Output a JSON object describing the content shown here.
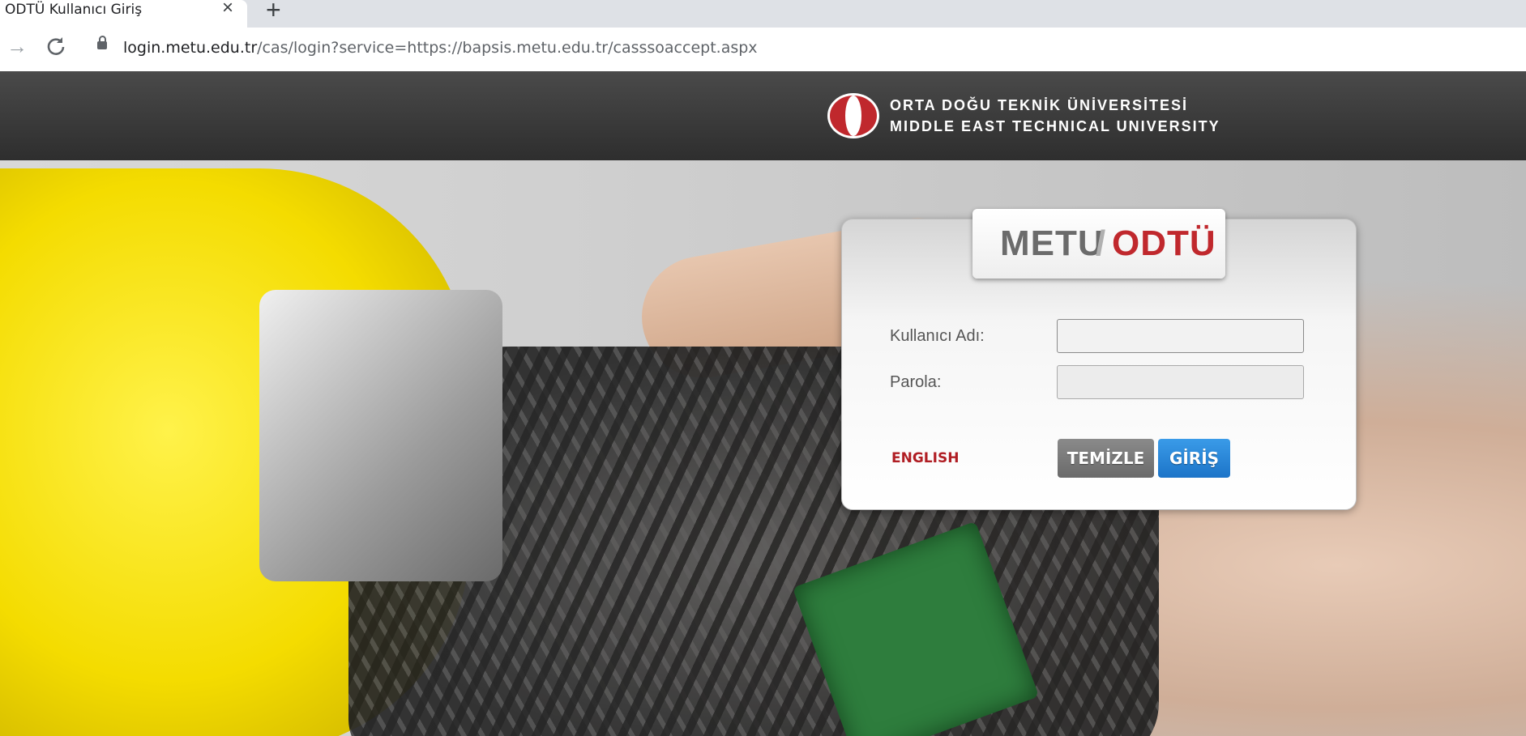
{
  "browser": {
    "tab_title": "ODTÜ Kullanıcı Giriş",
    "tab_close": "×",
    "new_tab": "+",
    "forward_icon": "→",
    "reload_icon": "C",
    "url_host": "login.metu.edu.tr",
    "url_rest": "/cas/login?service=https://bapsis.metu.edu.tr/casssoaccept.aspx"
  },
  "header": {
    "university_tr": "ORTA DOĞU TEKNİK ÜNİVERSİTESİ",
    "university_en": "MIDDLE EAST TECHNICAL UNIVERSITY",
    "logo_colors": {
      "red": "#c0282d",
      "white": "#ffffff"
    }
  },
  "login": {
    "brand_metu": "METU",
    "brand_slash": "/",
    "brand_odtu": "ODTÜ",
    "username_label": "Kullanıcı Adı:",
    "username_value": "",
    "password_label": "Parola:",
    "password_value": "",
    "language_link": "ENGLISH",
    "clear_button": "TEMİZLE",
    "login_button": "GİRİŞ"
  },
  "colors": {
    "brand_red": "#c0282d",
    "login_blue": "#1c74c8",
    "clear_gray": "#6a6a6a",
    "header_dark": "#2e2e2e"
  }
}
